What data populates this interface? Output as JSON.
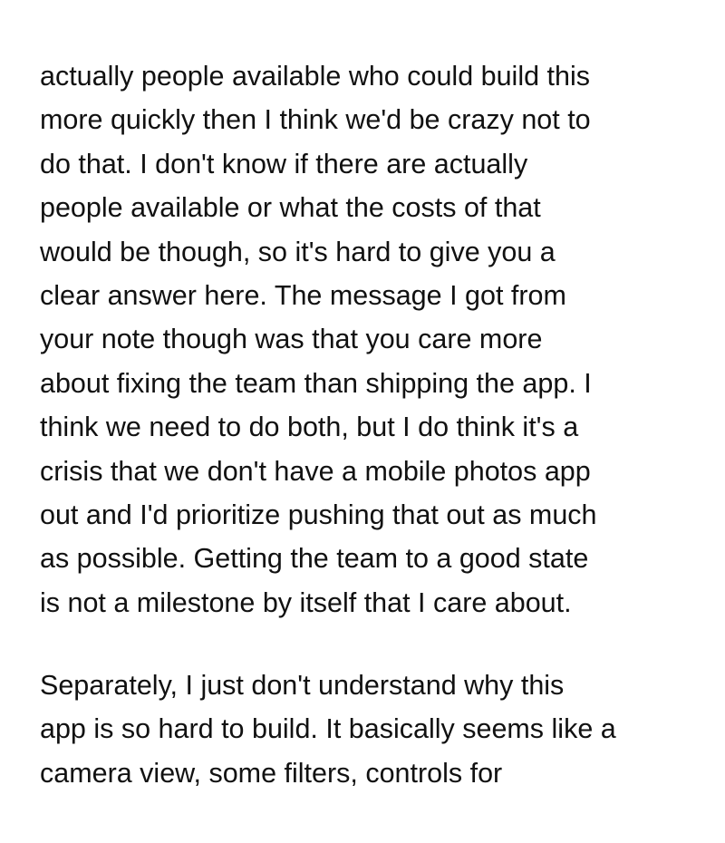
{
  "document": {
    "paragraphs": [
      {
        "lines": [
          "actually people available who could build this",
          "more quickly then I think we'd be crazy not to",
          "do that. I don't know if there are actually",
          "people available or what the costs of that",
          "would be though, so it's hard to give you a",
          "clear answer here. The message I got from",
          "your note though was that you care more",
          "about fixing the team than shipping the app. I",
          "think we need to do both, but I do think it's a",
          "crisis that we don't have a mobile photos app",
          "out and I'd prioritize pushing that out as much",
          "as possible. Getting the team to a good state",
          "is not a milestone by itself that I care about."
        ]
      },
      {
        "lines": [
          "Separately, I just don't understand why this",
          "app is so hard to build. It basically seems like a",
          "camera view, some filters, controls for"
        ]
      }
    ]
  }
}
